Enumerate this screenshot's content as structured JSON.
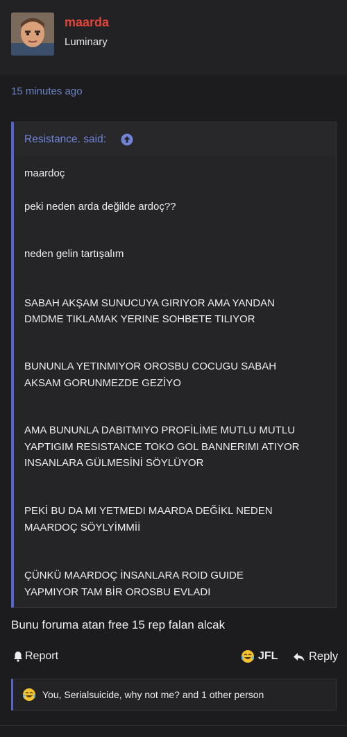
{
  "post": {
    "username": "maarda",
    "user_title": "Luminary",
    "timestamp": "15 minutes ago",
    "quote": {
      "attribution": "Resistance. said:",
      "lines": [
        "maardoç",
        "peki neden arda değilde ardoç??",
        "neden gelin tartışalım",
        "SABAH AKŞAM SUNUCUYA GIRIYOR AMA YANDAN",
        "DMDME TIKLAMAK YERINE SOHBETE TILIYOR",
        "BUNUNLA YETINMIYOR OROSBU COCUGU SABAH",
        "AKSAM GORUNMEZDE GEZİYO",
        "AMA BUNUNLA DABITMIYO PROFİLİME MUTLU MUTLU",
        "YAPTIGIM RESISTANCE TOKO GOL BANNERIMI ATIYOR",
        "INSANLARA GÜLMESİNİ SÖYLÜYOR",
        "PEKİ BU DA MI YETMEDI MAARDA DEĞİKL NEDEN",
        "MAARDOÇ SÖYLYİMMİİ",
        "ÇÜNKÜ MAARDOÇ İNSANLARA ROID GUIDE",
        "YAPMIYOR TAM BİR OROSBU EVLADI"
      ]
    },
    "message": "Bunu foruma atan free 15 rep falan alcak"
  },
  "actions": {
    "report_label": "Report",
    "reaction_label": "JFL",
    "reply_label": "Reply"
  },
  "reactions_summary": "You, Serialsuicide, why not me? and 1 other person",
  "icons": {
    "report": "bell-icon",
    "quote_jump": "arrow-up-circle-icon",
    "reaction": "joy-emoji-icon",
    "reply": "reply-arrow-icon"
  },
  "colors": {
    "username": "#e0453a",
    "accent": "#5565c9",
    "link": "#6b82c4",
    "background": "#1c1c1e"
  }
}
